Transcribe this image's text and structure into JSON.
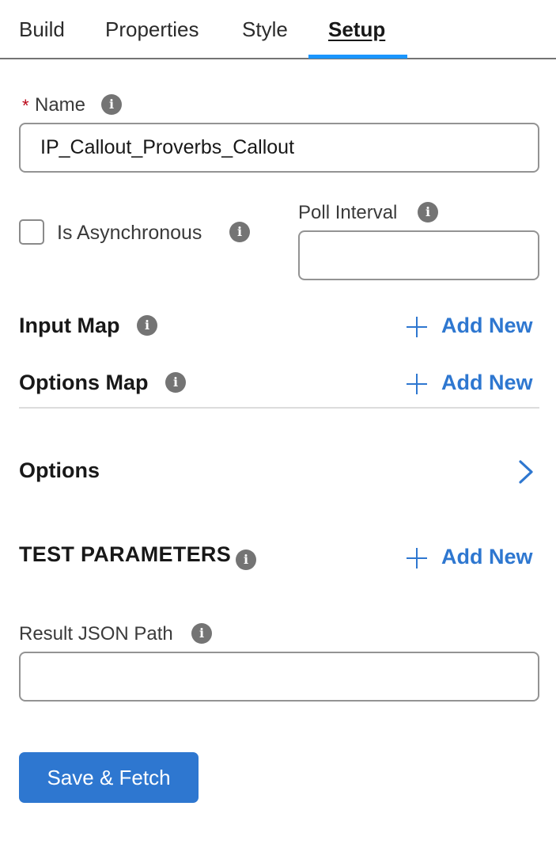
{
  "tabs": [
    {
      "label": "Build",
      "active": false
    },
    {
      "label": "Properties",
      "active": false
    },
    {
      "label": "Style",
      "active": false
    },
    {
      "label": "Setup",
      "active": true
    }
  ],
  "name_field": {
    "required_marker": "*",
    "label": "Name",
    "value": "IP_Callout_Proverbs_Callout"
  },
  "async": {
    "label": "Is Asynchronous",
    "checked": false
  },
  "poll_interval": {
    "label": "Poll Interval",
    "value": ""
  },
  "input_map": {
    "title": "Input Map",
    "add_label": "Add New"
  },
  "options_map": {
    "title": "Options Map",
    "add_label": "Add New"
  },
  "options": {
    "title": "Options"
  },
  "test_parameters": {
    "title": "TEST PARAMETERS",
    "add_label": "Add New"
  },
  "result_json_path": {
    "label": "Result JSON Path",
    "value": ""
  },
  "save_button": {
    "label": "Save & Fetch"
  },
  "icons": {
    "info": "info-icon",
    "add": "plus-icon",
    "expand": "chevron-right-icon"
  },
  "colors": {
    "accent": "#2e77d0",
    "tab_underline": "#1b96ff",
    "required": "#ba0517"
  }
}
